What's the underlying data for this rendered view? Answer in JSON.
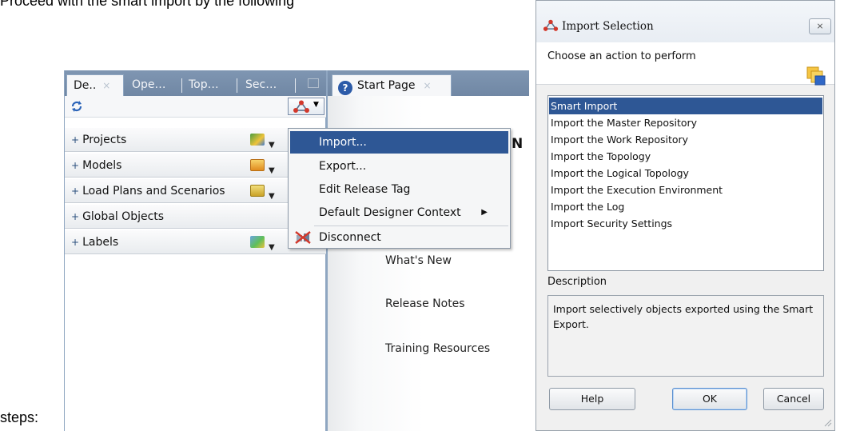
{
  "intro": {
    "line1": "Proceed with the smart import by the following",
    "line2": "steps:"
  },
  "designer": {
    "tabs": [
      {
        "label": "De..",
        "close": "×"
      },
      {
        "label": "Ope…"
      },
      {
        "label": "Top…"
      },
      {
        "label": "Sec…"
      }
    ],
    "accordions": [
      {
        "label": "Projects",
        "icon": "projects-icon"
      },
      {
        "label": "Models",
        "icon": "models-icon"
      },
      {
        "label": "Load Plans and Scenarios",
        "icon": "load-plans-icon"
      },
      {
        "label": "Global Objects",
        "icon": ""
      },
      {
        "label": "Labels",
        "icon": "labels-icon"
      }
    ],
    "expand_glyph": "+"
  },
  "start_page": {
    "tab_label": "Start Page",
    "tab_close": "×",
    "links": [
      "What's New",
      "Release Notes",
      "Training Resources"
    ],
    "partial_text": "N"
  },
  "context_menu": {
    "items": [
      {
        "label": "Import...",
        "highlighted": true
      },
      {
        "label": "Export...",
        "highlighted": false
      },
      {
        "label": "Edit Release Tag",
        "highlighted": false
      },
      {
        "label": "Default Designer Context",
        "highlighted": false,
        "submenu": true
      },
      {
        "label": "Disconnect",
        "highlighted": false
      }
    ],
    "submenu_arrow": "▶"
  },
  "dialog": {
    "title": "Import Selection",
    "close": "⨯",
    "prompt": "Choose an action to perform",
    "actions": [
      "Smart Import",
      "Import the Master Repository",
      "Import the Work Repository",
      "Import the Topology",
      "Import the Logical Topology",
      "Import the Execution Environment",
      "Import the Log",
      "Import Security Settings"
    ],
    "selected_index": 0,
    "description_label": "Description",
    "description_text": "Import selectively objects exported using the Smart Export.",
    "buttons": {
      "help": "Help",
      "ok": "OK",
      "cancel": "Cancel"
    }
  },
  "colors": {
    "selection": "#2e5795",
    "tabstrip": "#7f96b2",
    "odi_red": "#d2382b"
  }
}
